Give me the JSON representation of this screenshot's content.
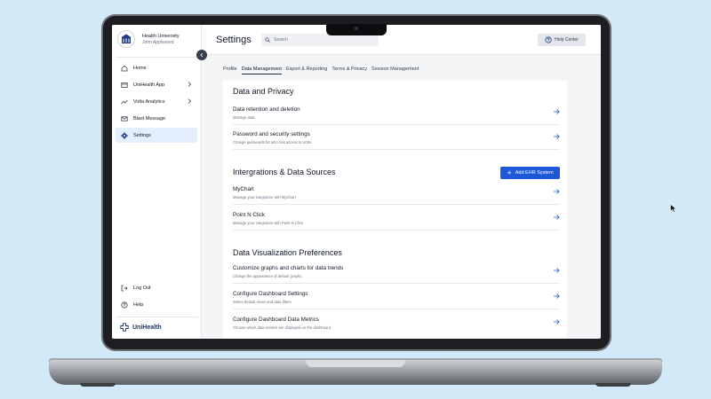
{
  "sidebar": {
    "brand_name": "Health University",
    "brand_user": "John Appleseed",
    "items": [
      {
        "label": "Home",
        "icon": "home-icon"
      },
      {
        "label": "UniHealth App",
        "icon": "app-window-icon"
      },
      {
        "label": "Volta Analytics",
        "icon": "trend-line-icon"
      },
      {
        "label": "Blast Message",
        "icon": "mail-icon"
      },
      {
        "label": "Settings",
        "icon": "gear-icon"
      }
    ],
    "bottom_items": [
      {
        "label": "Log Out",
        "icon": "logout-icon"
      },
      {
        "label": "Help",
        "icon": "help-circle-icon"
      }
    ],
    "footer_brand": "UniHealth"
  },
  "header": {
    "title": "Settings",
    "search_placeholder": "Search",
    "help_label": "Help Center"
  },
  "tabs": [
    {
      "label": "Profile"
    },
    {
      "label": "Data Management"
    },
    {
      "label": "Export & Reporting"
    },
    {
      "label": "Terms & Privacy"
    },
    {
      "label": "Session Management"
    }
  ],
  "sections": {
    "privacy": {
      "title": "Data and Privacy",
      "rows": [
        {
          "title": "Data retention and deletion",
          "subtitle": "Manage data"
        },
        {
          "title": "Password and security settings",
          "subtitle": "Change passwords for who has access to Volta"
        }
      ]
    },
    "integrations": {
      "title": "Intergrations & Data Sources",
      "add_label": "Add EHR System",
      "rows": [
        {
          "title": "MyChart",
          "subtitle": "Manage your integration with MyChart"
        },
        {
          "title": "Point N Click",
          "subtitle": "Manage your integration with Point N Click"
        }
      ]
    },
    "visualization": {
      "title": "Data Visualization Preferences",
      "rows": [
        {
          "title": "Customize graphs and charts for data trends",
          "subtitle": "Change the appearance of default graphs"
        },
        {
          "title": "Configure Dashboard Settings",
          "subtitle": "Select default views and data filters"
        },
        {
          "title": "Configure Dashboard Data Metrics",
          "subtitle": "Choose which data metrics are displayed on the dashboard"
        }
      ]
    }
  },
  "colors": {
    "background": "#d4e9f8",
    "accent": "#1f57d8",
    "active_nav": "#e3effc",
    "brand_navy": "#1f3556"
  }
}
